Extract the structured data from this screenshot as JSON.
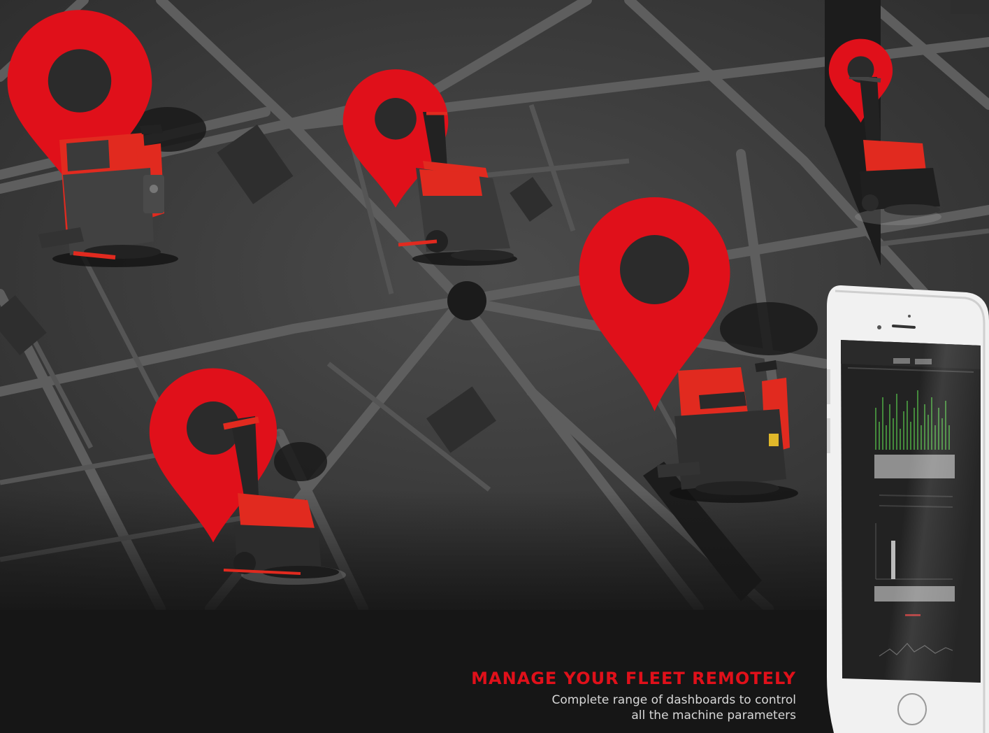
{
  "tagline": {
    "headline": "MANAGE YOUR FLEET REMOTELY",
    "description_line_1": "Complete range of dashboards  to control",
    "description_line_2": "all the machine parameters"
  },
  "colors": {
    "pin_red": "#e0101a",
    "map_block": "#454545",
    "street": "#5d5d5d",
    "background_dark": "#161616",
    "headline_red": "#e0101a",
    "dashboard_green": "#57c24a"
  },
  "icons": [
    "location-pin-icon",
    "floor-scrubber-machine",
    "smartphone-dashboard"
  ]
}
